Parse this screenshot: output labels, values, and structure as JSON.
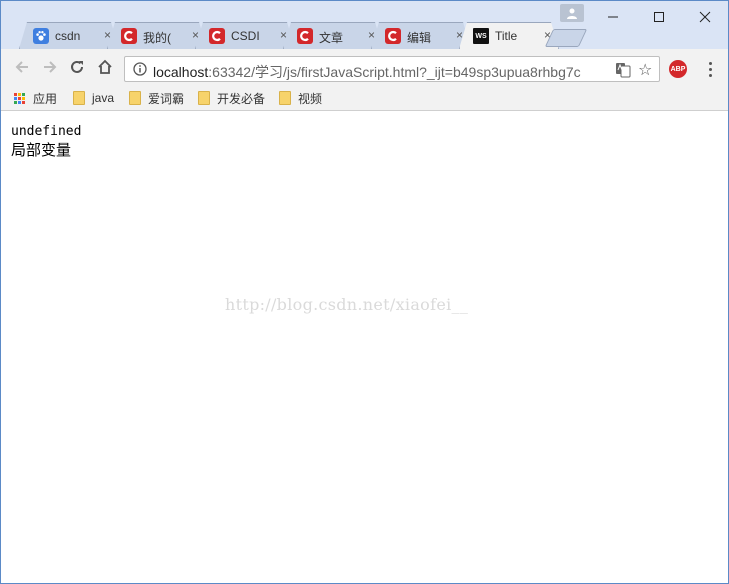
{
  "tabs": [
    {
      "label": "csdn",
      "favicon": "paw-icon",
      "close": "×"
    },
    {
      "label": "我的(",
      "favicon": "csdn-c-icon",
      "close": "×"
    },
    {
      "label": "CSDI",
      "favicon": "csdn-c-icon",
      "close": "×"
    },
    {
      "label": "文章",
      "favicon": "csdn-c-icon",
      "close": "×"
    },
    {
      "label": "编辑",
      "favicon": "csdn-c-icon",
      "close": "×"
    },
    {
      "label": "Title",
      "favicon": "webstorm-icon",
      "favicon_text": "WS",
      "close": "×"
    }
  ],
  "toolbar": {
    "url_host": "localhost",
    "url_rest": ":63342/学习/js/firstJavaScript.html?_ijt=b49sp3upua8rhbg7c",
    "abp_label": "ABP"
  },
  "bookmarks": [
    {
      "label": "应用",
      "icon": "apps-icon"
    },
    {
      "label": "java",
      "icon": "folder-icon"
    },
    {
      "label": "爱词霸",
      "icon": "folder-icon"
    },
    {
      "label": "开发必备",
      "icon": "folder-icon"
    },
    {
      "label": "视频",
      "icon": "folder-icon"
    }
  ],
  "content": {
    "line1": "undefined",
    "line2": "局部变量",
    "watermark": "http://blog.csdn.net/xiaofei__"
  },
  "colors": {
    "accent_csdn": "#d3282b",
    "tabstrip": "#dae4f5",
    "toolbar": "#f2f2f2"
  }
}
